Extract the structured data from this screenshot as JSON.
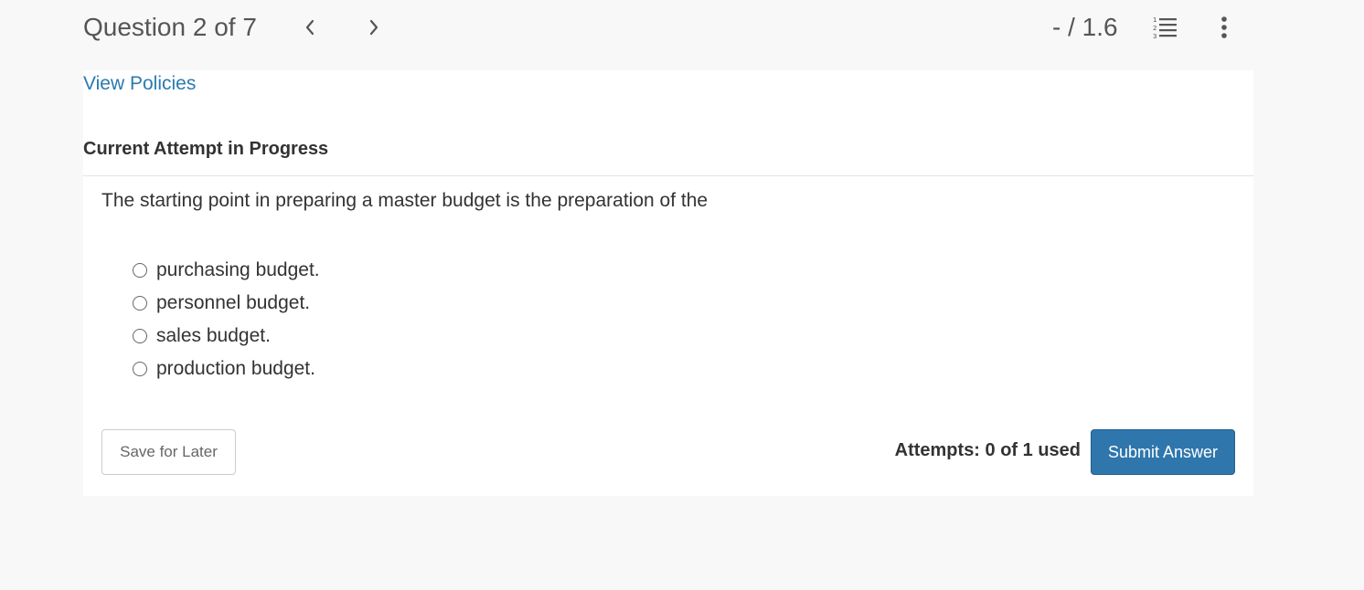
{
  "header": {
    "question_counter": "Question 2 of 7",
    "score": "- / 1.6",
    "icons": {
      "previous": "chevron-left-icon",
      "next": "chevron-right-icon",
      "question_list": "numbered-list-icon",
      "more": "vertical-ellipsis-icon"
    }
  },
  "main": {
    "policies_link": "View Policies",
    "attempt_heading": "Current Attempt in Progress",
    "question": "The starting point in preparing a master budget is the preparation of the",
    "choices": [
      {
        "label": "purchasing budget.",
        "selected": false
      },
      {
        "label": "personnel budget.",
        "selected": false
      },
      {
        "label": "sales budget.",
        "selected": false
      },
      {
        "label": "production budget.",
        "selected": false
      }
    ]
  },
  "footer": {
    "save_label": "Save for Later",
    "attempts_text": "Attempts: 0 of 1 used",
    "submit_label": "Submit Answer"
  },
  "colors": {
    "page_background": "#f8f8f8",
    "card_background": "#ffffff",
    "link": "#2a7ab0",
    "primary_button": "#2f76ad",
    "text": "#333333"
  }
}
